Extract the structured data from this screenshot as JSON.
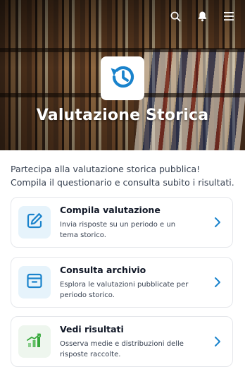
{
  "hero": {
    "title": "Valutazione Storica",
    "logo_icon": "history-clock-icon",
    "accent": "#1a83cc"
  },
  "topbar": {
    "icons": [
      "search-icon",
      "notification-icon",
      "menu-icon"
    ]
  },
  "intro": "Partecipa alla valutazione storica pubblica! Compila il questionario e consulta subito i risultati.",
  "cards": [
    {
      "title": "Compila valutazione",
      "description": "Invia risposte su un periodo e un tema storico.",
      "icon": "edit-icon",
      "badge_color": "#e6f3fb"
    },
    {
      "title": "Consulta archivio",
      "description": "Esplora le valutazioni pubblicate per periodo storico.",
      "icon": "archive-icon",
      "badge_color": "#e6f3fb"
    },
    {
      "title": "Vedi risultati",
      "description": "Osserva medie e distribuzioni delle risposte raccolte.",
      "icon": "chart-growth-icon",
      "badge_color": "#eef6ee"
    }
  ]
}
